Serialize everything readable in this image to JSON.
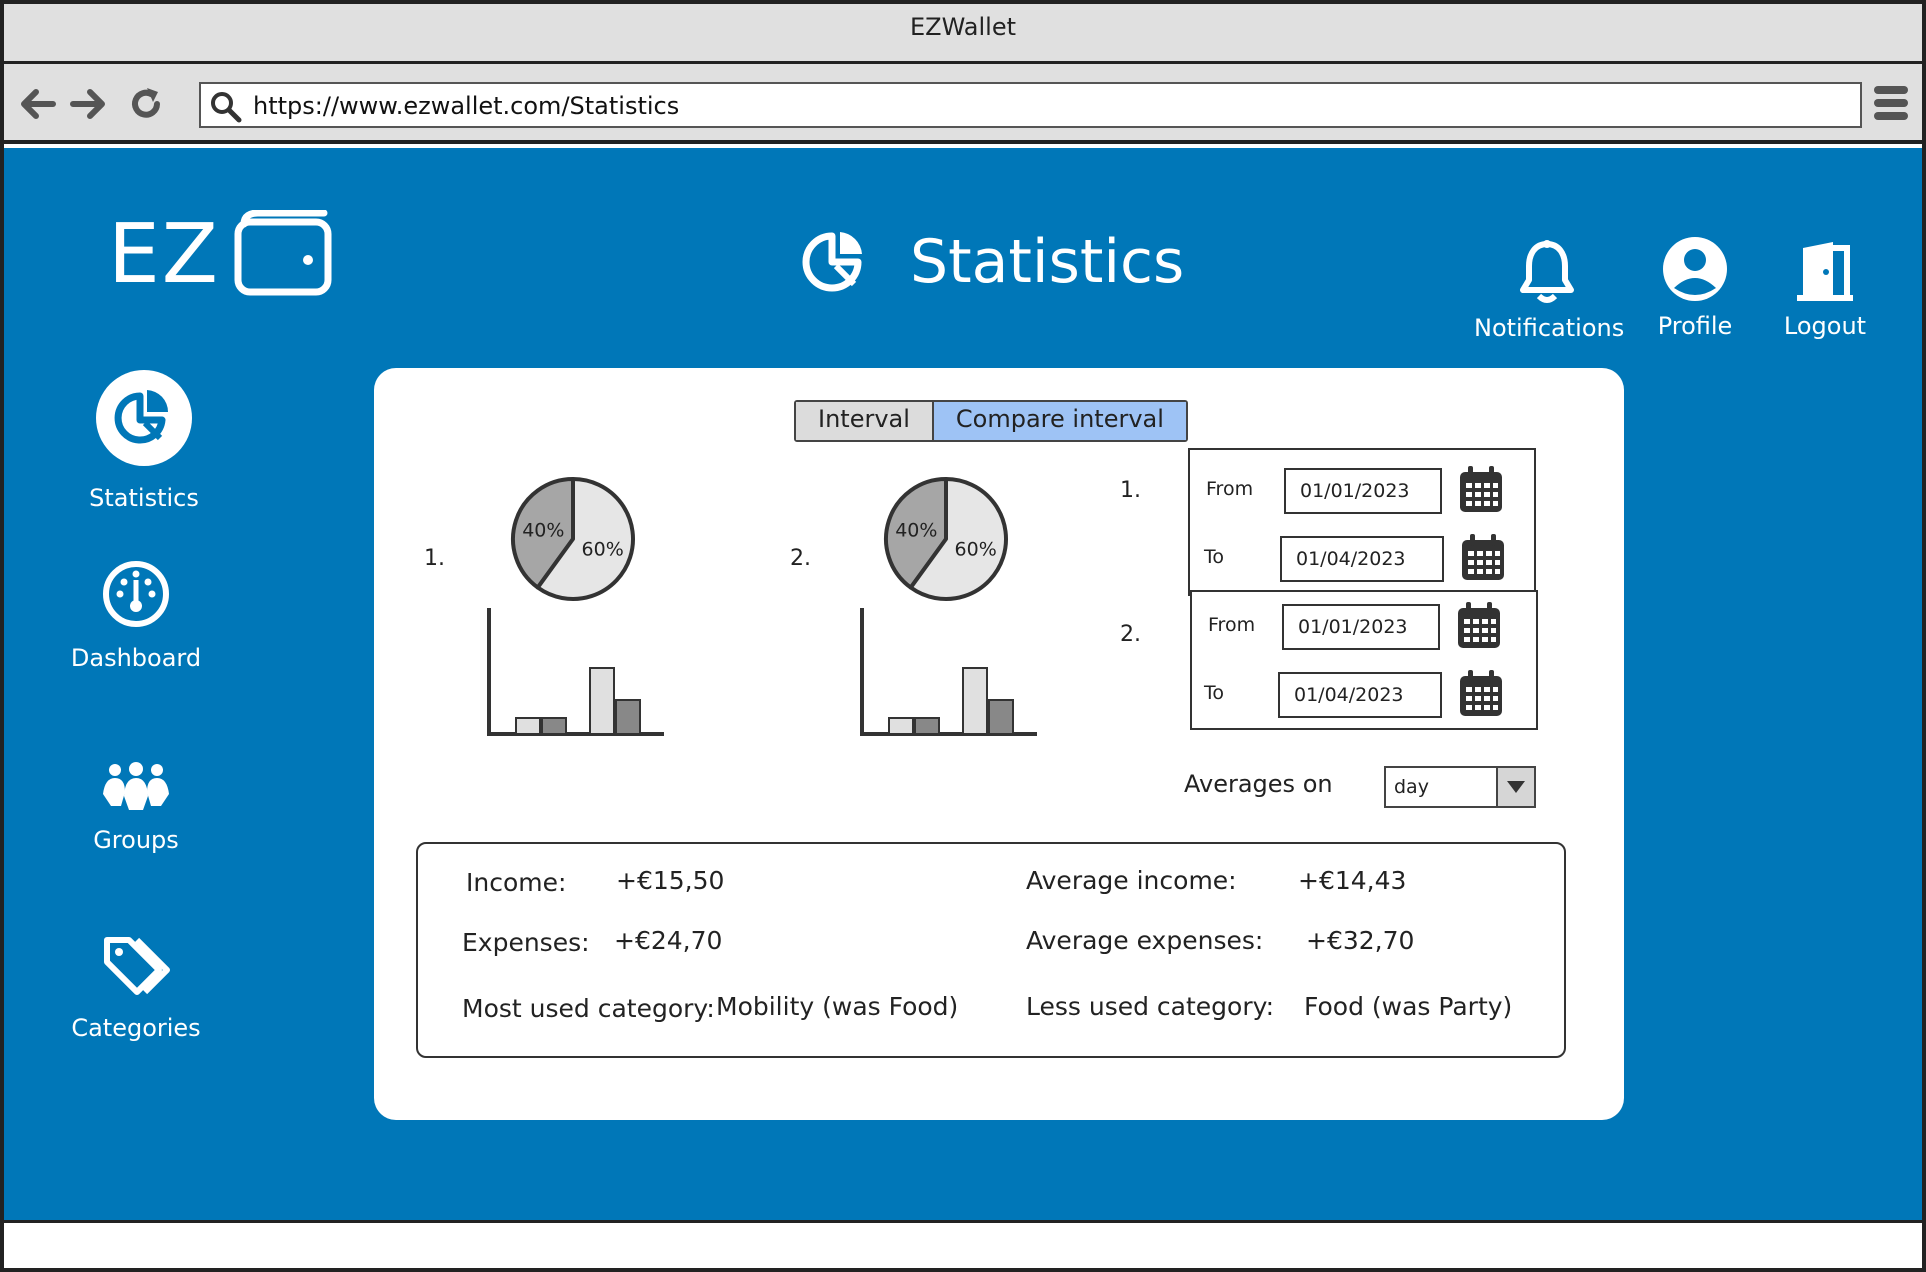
{
  "browser": {
    "window_title": "EZWallet",
    "url": "https://www.ezwallet.com/Statistics"
  },
  "logo": {
    "text": "EZ"
  },
  "header": {
    "title": "Statistics",
    "notifications_label": "Notifications",
    "profile_label": "Profile",
    "logout_label": "Logout"
  },
  "sidebar": {
    "items": [
      {
        "label": "Statistics",
        "icon": "pie-chart-icon",
        "active": true
      },
      {
        "label": "Dashboard",
        "icon": "gauge-icon",
        "active": false
      },
      {
        "label": "Groups",
        "icon": "group-icon",
        "active": false
      },
      {
        "label": "Categories",
        "icon": "tags-icon",
        "active": false
      }
    ]
  },
  "tabs": {
    "interval_label": "Interval",
    "compare_label": "Compare interval",
    "active": "Compare interval"
  },
  "charts": {
    "one": {
      "index_label": "1.",
      "pie_left_label": "40%",
      "pie_right_label": "60%"
    },
    "two": {
      "index_label": "2.",
      "pie_left_label": "40%",
      "pie_right_label": "60%"
    }
  },
  "chart_data": [
    {
      "type": "pie",
      "labels": [
        "40%",
        "60%"
      ],
      "values": [
        40,
        60
      ],
      "colors": [
        "#a6a6a6",
        "#e6e6e6"
      ]
    },
    {
      "type": "bar",
      "values": [
        1,
        1,
        4,
        2
      ],
      "colors": [
        "#e0e0e0",
        "#888888",
        "#e0e0e0",
        "#888888"
      ]
    },
    {
      "type": "pie",
      "labels": [
        "40%",
        "60%"
      ],
      "values": [
        40,
        60
      ],
      "colors": [
        "#a6a6a6",
        "#e6e6e6"
      ]
    },
    {
      "type": "bar",
      "values": [
        1,
        1,
        4,
        2
      ],
      "colors": [
        "#e0e0e0",
        "#888888",
        "#e0e0e0",
        "#888888"
      ]
    }
  ],
  "intervals": [
    {
      "index_label": "1.",
      "from_label": "From",
      "from_value": "01/01/2023",
      "to_label": "To",
      "to_value": "01/04/2023"
    },
    {
      "index_label": "2.",
      "from_label": "From",
      "from_value": "01/01/2023",
      "to_label": "To",
      "to_value": "01/04/2023"
    }
  ],
  "averages": {
    "label": "Averages on",
    "selected": "day"
  },
  "summary": {
    "income_label": "Income:",
    "income_value": "+€15,50",
    "expenses_label": "Expenses:",
    "expenses_value": "+€24,70",
    "most_used_label": "Most used category:",
    "most_used_value": "Mobility (was Food)",
    "avg_income_label": "Average income:",
    "avg_income_value": "+€14,43",
    "avg_expenses_label": "Average expenses:",
    "avg_expenses_value": "+€32,70",
    "less_used_label": "Less used category:",
    "less_used_value": "Food (was Party)"
  },
  "colors": {
    "app_background": "#0077b8",
    "active_tab": "#9ec3f5",
    "card": "#ffffff"
  }
}
